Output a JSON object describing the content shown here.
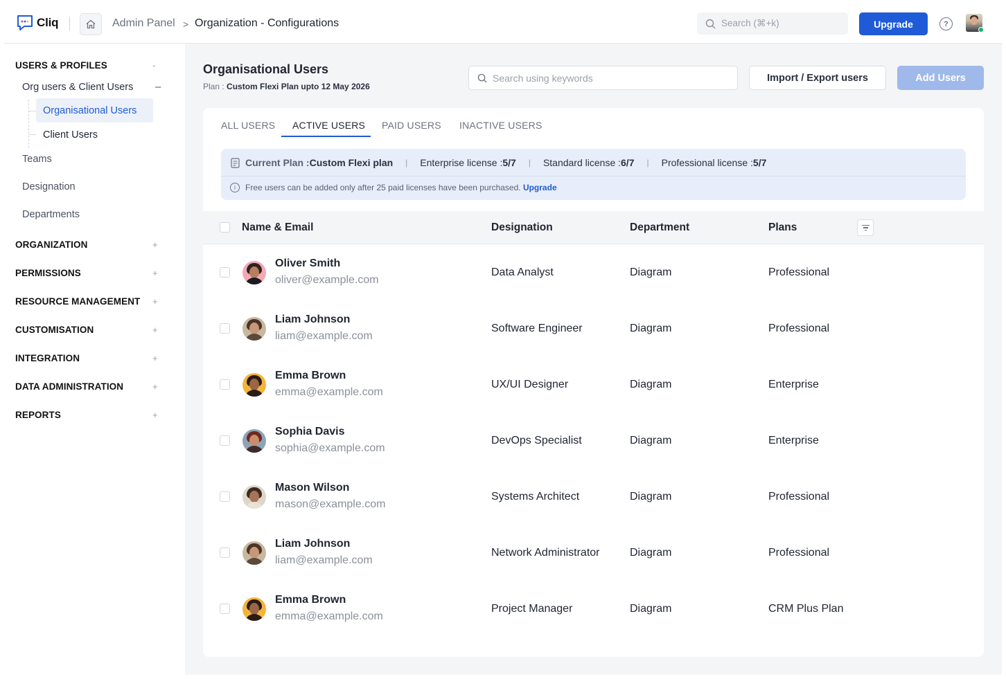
{
  "app": {
    "name": "Cliq"
  },
  "breadcrumb": {
    "root": "Admin Panel",
    "separator": ">",
    "current": "Organization - Configurations"
  },
  "topbar": {
    "search_placeholder": "Search  (⌘+k)",
    "upgrade_label": "Upgrade",
    "help_glyph": "?"
  },
  "sidebar": {
    "users_profiles": {
      "label": "USERS & PROFILES",
      "toggle": "-",
      "group": {
        "label": "Org users & Client Users",
        "toggle": "–"
      },
      "leaves": [
        "Organisational Users",
        "Client Users"
      ],
      "items": [
        "Teams",
        "Designation",
        "Departments"
      ]
    },
    "sections": [
      {
        "label": "ORGANIZATION",
        "toggle": "+"
      },
      {
        "label": "PERMISSIONS",
        "toggle": "+"
      },
      {
        "label": "RESOURCE MANAGEMENT",
        "toggle": "+"
      },
      {
        "label": "CUSTOMISATION",
        "toggle": "+"
      },
      {
        "label": "INTEGRATION",
        "toggle": "+"
      },
      {
        "label": "DATA ADMINISTRATION",
        "toggle": "+"
      },
      {
        "label": "REPORTS",
        "toggle": "+"
      }
    ]
  },
  "page": {
    "title": "Organisational Users",
    "plan_prefix": "Plan : ",
    "plan_value": "Custom Flexi Plan upto 12 May 2026",
    "search_placeholder": "Search using keywords",
    "import_export_label": "Import / Export users",
    "add_users_label": "Add Users"
  },
  "tabs": [
    "ALL USERS",
    "ACTIVE USERS",
    "PAID USERS",
    "INACTIVE USERS"
  ],
  "active_tab": "ACTIVE USERS",
  "license": {
    "current_plan_label": "Current Plan : ",
    "current_plan_value": "Custom Flexi plan",
    "enterprise_label": "Enterprise license : ",
    "enterprise_value": "5/7",
    "standard_label": "Standard license : ",
    "standard_value": "6/7",
    "professional_label": "Professional license : ",
    "professional_value": "5/7",
    "separator": "|",
    "note": "Free users can be added only after 25 paid licenses have been purchased.",
    "note_link": "Upgrade"
  },
  "table": {
    "headers": {
      "name": "Name & Email",
      "designation": "Designation",
      "department": "Department",
      "plans": "Plans"
    },
    "rows": [
      {
        "name": "Oliver Smith",
        "email": "oliver@example.com",
        "designation": "Data Analyst",
        "department": "Diagram",
        "plan": "Professional"
      },
      {
        "name": "Liam Johnson",
        "email": "liam@example.com",
        "designation": "Software Engineer",
        "department": "Diagram",
        "plan": "Professional"
      },
      {
        "name": "Emma Brown",
        "email": "emma@example.com",
        "designation": "UX/UI Designer",
        "department": "Diagram",
        "plan": "Enterprise"
      },
      {
        "name": "Sophia Davis",
        "email": "sophia@example.com",
        "designation": "DevOps Specialist",
        "department": "Diagram",
        "plan": "Enterprise"
      },
      {
        "name": "Mason Wilson",
        "email": "mason@example.com",
        "designation": "Systems Architect",
        "department": "Diagram",
        "plan": "Professional"
      },
      {
        "name": "Liam Johnson",
        "email": "liam@example.com",
        "designation": "Network Administrator",
        "department": "Diagram",
        "plan": "Professional"
      },
      {
        "name": "Emma Brown",
        "email": "emma@example.com",
        "designation": "Project Manager",
        "department": "Diagram",
        "plan": "CRM Plus Plan"
      }
    ]
  },
  "colors": {
    "accent": "#1f5bd6",
    "add_button": "#9fb9ea",
    "license_bg": "#e8eef9",
    "online": "#16b364"
  }
}
